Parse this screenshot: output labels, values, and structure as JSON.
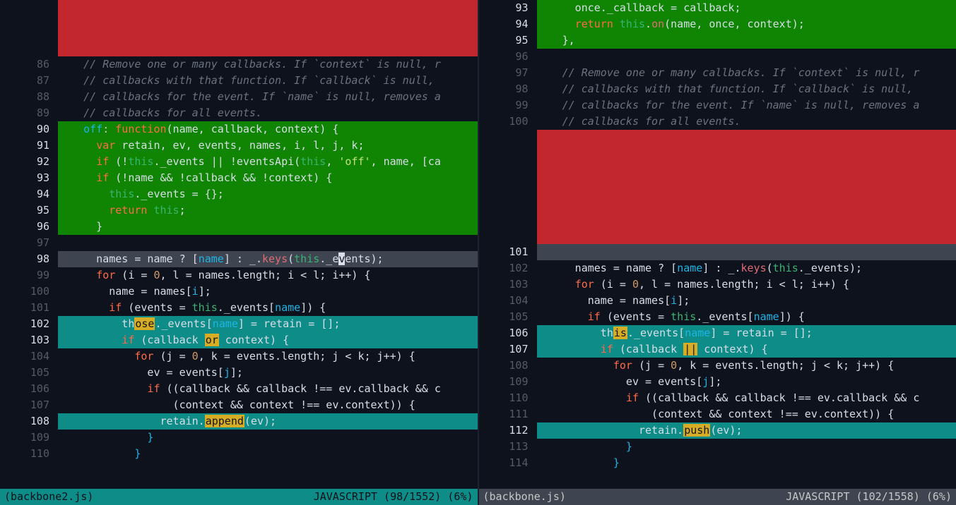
{
  "left": {
    "filename": "(backbone2.js)",
    "status_right": "JAVASCRIPT (98/1552) (6%)",
    "active": true,
    "lines": [
      {
        "num": "",
        "cls": "del",
        "segs": [
          {
            "t": " ",
            "c": ""
          }
        ],
        "redstripe": true,
        "h": 80
      },
      {
        "num": "86",
        "cls": "",
        "segs": [
          {
            "t": "    ",
            "c": ""
          },
          {
            "t": "// Remove one or many callbacks. If `context` is null, r",
            "c": "c-com"
          }
        ]
      },
      {
        "num": "87",
        "cls": "",
        "segs": [
          {
            "t": "    ",
            "c": ""
          },
          {
            "t": "// callbacks with that function. If `callback` is null, ",
            "c": "c-com"
          }
        ]
      },
      {
        "num": "88",
        "cls": "",
        "segs": [
          {
            "t": "    ",
            "c": ""
          },
          {
            "t": "// callbacks for the event. If `name` is null, removes a",
            "c": "c-com"
          }
        ]
      },
      {
        "num": "89",
        "cls": "",
        "segs": [
          {
            "t": "    ",
            "c": ""
          },
          {
            "t": "// callbacks for all events.",
            "c": "c-com"
          }
        ]
      },
      {
        "num": "90",
        "cls": "add",
        "segs": [
          {
            "t": "    ",
            "c": ""
          },
          {
            "t": "off",
            "c": "c-prop"
          },
          {
            "t": ": ",
            "c": "c-pun"
          },
          {
            "t": "function",
            "c": "c-kw"
          },
          {
            "t": "(name, callback, context) {",
            "c": "c-id"
          }
        ]
      },
      {
        "num": "91",
        "cls": "add",
        "segs": [
          {
            "t": "      ",
            "c": ""
          },
          {
            "t": "var",
            "c": "c-kw"
          },
          {
            "t": " retain, ev, events, names, i, l, j, k;",
            "c": "c-id"
          }
        ]
      },
      {
        "num": "92",
        "cls": "add",
        "segs": [
          {
            "t": "      ",
            "c": ""
          },
          {
            "t": "if",
            "c": "c-kw"
          },
          {
            "t": " (!",
            "c": "c-id"
          },
          {
            "t": "this",
            "c": "c-self"
          },
          {
            "t": "._events || !eventsApi(",
            "c": "c-id"
          },
          {
            "t": "this",
            "c": "c-self"
          },
          {
            "t": ", ",
            "c": "c-id"
          },
          {
            "t": "'off'",
            "c": "c-str"
          },
          {
            "t": ", name, [ca",
            "c": "c-id"
          }
        ]
      },
      {
        "num": "93",
        "cls": "add",
        "segs": [
          {
            "t": "      ",
            "c": ""
          },
          {
            "t": "if",
            "c": "c-kw"
          },
          {
            "t": " (!name && !callback && !context) {",
            "c": "c-id"
          }
        ]
      },
      {
        "num": "94",
        "cls": "add",
        "segs": [
          {
            "t": "        ",
            "c": ""
          },
          {
            "t": "this",
            "c": "c-self"
          },
          {
            "t": "._events = {};",
            "c": "c-id"
          }
        ]
      },
      {
        "num": "95",
        "cls": "add",
        "segs": [
          {
            "t": "        ",
            "c": ""
          },
          {
            "t": "return",
            "c": "c-kw"
          },
          {
            "t": " ",
            "c": ""
          },
          {
            "t": "this",
            "c": "c-self"
          },
          {
            "t": ";",
            "c": "c-id"
          }
        ]
      },
      {
        "num": "96",
        "cls": "add",
        "segs": [
          {
            "t": "      }",
            "c": "c-id"
          }
        ]
      },
      {
        "num": "97",
        "cls": "",
        "segs": [
          {
            "t": " ",
            "c": ""
          }
        ]
      },
      {
        "num": "98",
        "cls": "cur",
        "segs": [
          {
            "t": "      names = name ? [",
            "c": "c-id"
          },
          {
            "t": "name",
            "c": "c-prop"
          },
          {
            "t": "] : _.",
            "c": "c-id"
          },
          {
            "t": "keys",
            "c": "c-fn"
          },
          {
            "t": "(",
            "c": "c-id"
          },
          {
            "t": "this",
            "c": "c-self"
          },
          {
            "t": "._e",
            "c": "c-id"
          },
          {
            "t": "v",
            "c": "cursor"
          },
          {
            "t": "ents);",
            "c": "c-id"
          }
        ]
      },
      {
        "num": "99",
        "cls": "",
        "segs": [
          {
            "t": "      ",
            "c": ""
          },
          {
            "t": "for",
            "c": "c-kw"
          },
          {
            "t": " (i = ",
            "c": "c-id"
          },
          {
            "t": "0",
            "c": "c-num"
          },
          {
            "t": ", l = names.length; i < l; i++) {",
            "c": "c-id"
          }
        ]
      },
      {
        "num": "100",
        "cls": "",
        "segs": [
          {
            "t": "        name = names[",
            "c": "c-id"
          },
          {
            "t": "i",
            "c": "c-prop"
          },
          {
            "t": "];",
            "c": "c-id"
          }
        ]
      },
      {
        "num": "101",
        "cls": "",
        "segs": [
          {
            "t": "        ",
            "c": ""
          },
          {
            "t": "if",
            "c": "c-kw"
          },
          {
            "t": " (events = ",
            "c": "c-id"
          },
          {
            "t": "this",
            "c": "c-self"
          },
          {
            "t": "._events[",
            "c": "c-id"
          },
          {
            "t": "name",
            "c": "c-prop"
          },
          {
            "t": "]) {",
            "c": "c-id"
          }
        ]
      },
      {
        "num": "102",
        "cls": "chg",
        "segs": [
          {
            "t": "          th",
            "c": "c-id"
          },
          {
            "t": "ose",
            "c": "hl"
          },
          {
            "t": "._events[",
            "c": "c-id"
          },
          {
            "t": "name",
            "c": "c-prop"
          },
          {
            "t": "] = retain = [];",
            "c": "c-id"
          }
        ]
      },
      {
        "num": "103",
        "cls": "chg",
        "segs": [
          {
            "t": "          ",
            "c": ""
          },
          {
            "t": "if",
            "c": "c-kw"
          },
          {
            "t": " (callback ",
            "c": "c-id"
          },
          {
            "t": "or",
            "c": "hl"
          },
          {
            "t": " context) {",
            "c": "c-id"
          }
        ]
      },
      {
        "num": "104",
        "cls": "",
        "segs": [
          {
            "t": "            ",
            "c": ""
          },
          {
            "t": "for",
            "c": "c-kw"
          },
          {
            "t": " (j = ",
            "c": "c-id"
          },
          {
            "t": "0",
            "c": "c-num"
          },
          {
            "t": ", k = events.length; j < k; j++) {",
            "c": "c-id"
          }
        ]
      },
      {
        "num": "105",
        "cls": "",
        "segs": [
          {
            "t": "              ev = events[",
            "c": "c-id"
          },
          {
            "t": "j",
            "c": "c-prop"
          },
          {
            "t": "];",
            "c": "c-id"
          }
        ]
      },
      {
        "num": "106",
        "cls": "",
        "segs": [
          {
            "t": "              ",
            "c": ""
          },
          {
            "t": "if",
            "c": "c-kw"
          },
          {
            "t": " ((callback && callback !== ev.callback && c",
            "c": "c-id"
          }
        ]
      },
      {
        "num": "107",
        "cls": "",
        "segs": [
          {
            "t": "                  (context && context !== ev.context)) {",
            "c": "c-id"
          }
        ]
      },
      {
        "num": "108",
        "cls": "chg",
        "segs": [
          {
            "t": "                retain.",
            "c": "c-id"
          },
          {
            "t": "append",
            "c": "hl"
          },
          {
            "t": "(ev);",
            "c": "c-id"
          }
        ]
      },
      {
        "num": "109",
        "cls": "",
        "segs": [
          {
            "t": "              }",
            "c": "c-prop"
          }
        ]
      },
      {
        "num": "110",
        "cls": "",
        "segs": [
          {
            "t": "            }",
            "c": "c-prop"
          }
        ]
      }
    ]
  },
  "right": {
    "filename": "(backbone.js)",
    "status_right": "JAVASCRIPT (102/1558) (6%)",
    "active": false,
    "lines": [
      {
        "num": "93",
        "cls": "add",
        "segs": [
          {
            "t": "      once._callback = callback;",
            "c": "c-id"
          }
        ]
      },
      {
        "num": "94",
        "cls": "add",
        "segs": [
          {
            "t": "      ",
            "c": ""
          },
          {
            "t": "return",
            "c": "c-kw"
          },
          {
            "t": " ",
            "c": ""
          },
          {
            "t": "this",
            "c": "c-self"
          },
          {
            "t": ".",
            "c": "c-id"
          },
          {
            "t": "on",
            "c": "c-fn"
          },
          {
            "t": "(name, once, context);",
            "c": "c-id"
          }
        ]
      },
      {
        "num": "95",
        "cls": "add",
        "segs": [
          {
            "t": "    },",
            "c": "c-id"
          }
        ]
      },
      {
        "num": "96",
        "cls": "",
        "segs": [
          {
            "t": " ",
            "c": ""
          }
        ]
      },
      {
        "num": "97",
        "cls": "",
        "segs": [
          {
            "t": "    ",
            "c": ""
          },
          {
            "t": "// Remove one or many callbacks. If `context` is null, r",
            "c": "c-com"
          }
        ]
      },
      {
        "num": "98",
        "cls": "",
        "segs": [
          {
            "t": "    ",
            "c": ""
          },
          {
            "t": "// callbacks with that function. If `callback` is null, ",
            "c": "c-com"
          }
        ]
      },
      {
        "num": "99",
        "cls": "",
        "segs": [
          {
            "t": "    ",
            "c": ""
          },
          {
            "t": "// callbacks for the event. If `name` is null, removes a",
            "c": "c-com"
          }
        ]
      },
      {
        "num": "100",
        "cls": "",
        "segs": [
          {
            "t": "    ",
            "c": ""
          },
          {
            "t": "// callbacks for all events.",
            "c": "c-com"
          }
        ]
      },
      {
        "num": "",
        "cls": "del",
        "segs": [
          {
            "t": " ",
            "c": ""
          }
        ],
        "redstripe": true,
        "h": 162
      },
      {
        "num": "101",
        "cls": "cur",
        "segs": [
          {
            "t": " ",
            "c": ""
          }
        ]
      },
      {
        "num": "102",
        "cls": "",
        "segs": [
          {
            "t": "      names = name ? [",
            "c": "c-id"
          },
          {
            "t": "name",
            "c": "c-prop"
          },
          {
            "t": "] : _.",
            "c": "c-id"
          },
          {
            "t": "keys",
            "c": "c-fn"
          },
          {
            "t": "(",
            "c": "c-id"
          },
          {
            "t": "this",
            "c": "c-self"
          },
          {
            "t": "._events);",
            "c": "c-id"
          }
        ]
      },
      {
        "num": "103",
        "cls": "",
        "segs": [
          {
            "t": "      ",
            "c": ""
          },
          {
            "t": "for",
            "c": "c-kw"
          },
          {
            "t": " (i = ",
            "c": "c-id"
          },
          {
            "t": "0",
            "c": "c-num"
          },
          {
            "t": ", l = names.length; i < l; i++) {",
            "c": "c-id"
          }
        ]
      },
      {
        "num": "104",
        "cls": "",
        "segs": [
          {
            "t": "        name = names[",
            "c": "c-id"
          },
          {
            "t": "i",
            "c": "c-prop"
          },
          {
            "t": "];",
            "c": "c-id"
          }
        ]
      },
      {
        "num": "105",
        "cls": "",
        "segs": [
          {
            "t": "        ",
            "c": ""
          },
          {
            "t": "if",
            "c": "c-kw"
          },
          {
            "t": " (events = ",
            "c": "c-id"
          },
          {
            "t": "this",
            "c": "c-self"
          },
          {
            "t": "._events[",
            "c": "c-id"
          },
          {
            "t": "name",
            "c": "c-prop"
          },
          {
            "t": "]) {",
            "c": "c-id"
          }
        ]
      },
      {
        "num": "106",
        "cls": "chg",
        "segs": [
          {
            "t": "          th",
            "c": "c-id"
          },
          {
            "t": "is",
            "c": "hl"
          },
          {
            "t": "._events[",
            "c": "c-id"
          },
          {
            "t": "name",
            "c": "c-prop"
          },
          {
            "t": "] = retain = [];",
            "c": "c-id"
          }
        ]
      },
      {
        "num": "107",
        "cls": "chg",
        "segs": [
          {
            "t": "          ",
            "c": ""
          },
          {
            "t": "if",
            "c": "c-kw"
          },
          {
            "t": " (callback ",
            "c": "c-id"
          },
          {
            "t": "||",
            "c": "hl"
          },
          {
            "t": " context) {",
            "c": "c-id"
          }
        ]
      },
      {
        "num": "108",
        "cls": "",
        "segs": [
          {
            "t": "            ",
            "c": ""
          },
          {
            "t": "for",
            "c": "c-kw"
          },
          {
            "t": " (j = ",
            "c": "c-id"
          },
          {
            "t": "0",
            "c": "c-num"
          },
          {
            "t": ", k = events.length; j < k; j++) {",
            "c": "c-id"
          }
        ]
      },
      {
        "num": "109",
        "cls": "",
        "segs": [
          {
            "t": "              ev = events[",
            "c": "c-id"
          },
          {
            "t": "j",
            "c": "c-prop"
          },
          {
            "t": "];",
            "c": "c-id"
          }
        ]
      },
      {
        "num": "110",
        "cls": "",
        "segs": [
          {
            "t": "              ",
            "c": ""
          },
          {
            "t": "if",
            "c": "c-kw"
          },
          {
            "t": " ((callback && callback !== ev.callback && c",
            "c": "c-id"
          }
        ]
      },
      {
        "num": "111",
        "cls": "",
        "segs": [
          {
            "t": "                  (context && context !== ev.context)) {",
            "c": "c-id"
          }
        ]
      },
      {
        "num": "112",
        "cls": "chg",
        "segs": [
          {
            "t": "                retain.",
            "c": "c-id"
          },
          {
            "t": "push",
            "c": "hl"
          },
          {
            "t": "(ev);",
            "c": "c-id"
          }
        ]
      },
      {
        "num": "113",
        "cls": "",
        "segs": [
          {
            "t": "              }",
            "c": "c-prop"
          }
        ]
      },
      {
        "num": "114",
        "cls": "",
        "segs": [
          {
            "t": "            }",
            "c": "c-prop"
          }
        ]
      }
    ]
  }
}
